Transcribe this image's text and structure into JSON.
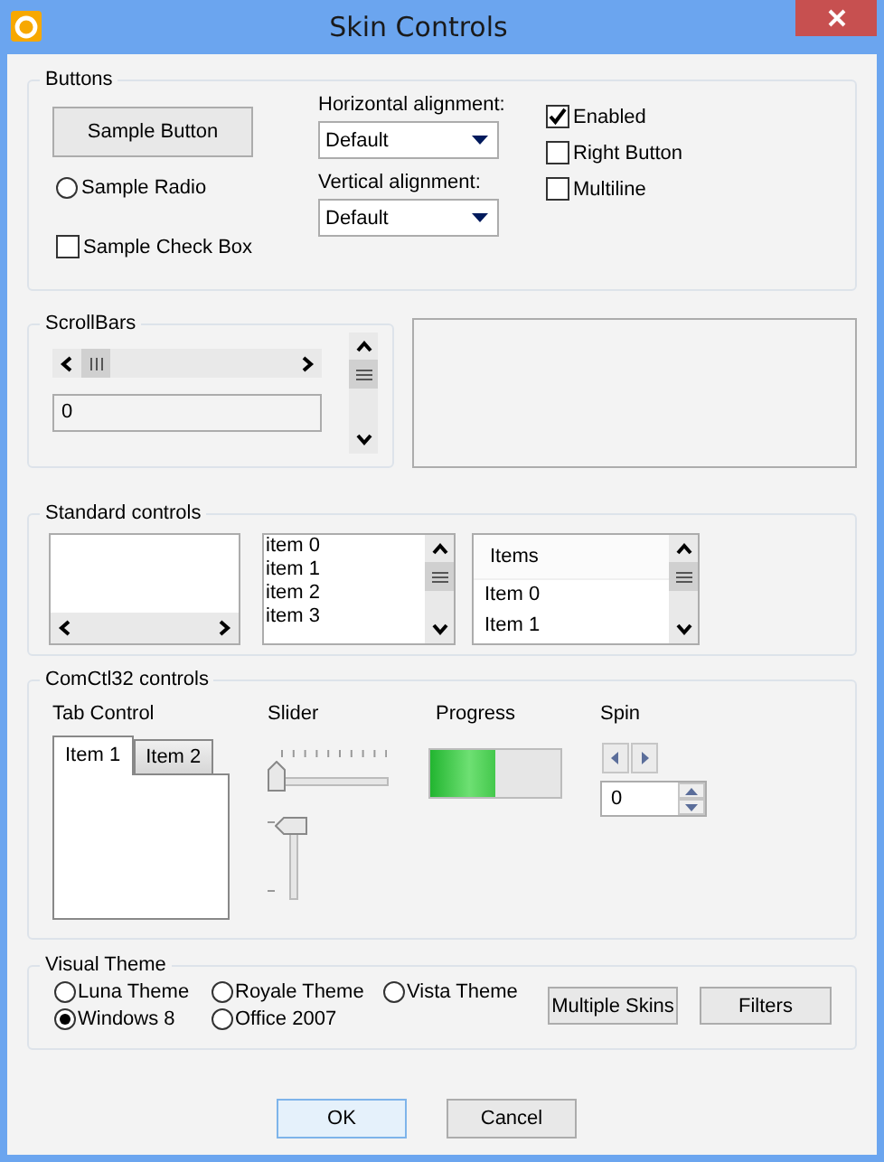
{
  "window": {
    "title": "Skin Controls"
  },
  "buttons_group": {
    "legend": "Buttons",
    "sample_button": "Sample Button",
    "sample_radio": {
      "label": "Sample Radio",
      "selected": false
    },
    "sample_checkbox": {
      "label": "Sample Check Box",
      "checked": false
    },
    "horizontal_alignment": {
      "label": "Horizontal alignment:",
      "value": "Default"
    },
    "vertical_alignment": {
      "label": "Vertical alignment:",
      "value": "Default"
    },
    "options": [
      {
        "label": "Enabled",
        "checked": true
      },
      {
        "label": "Right Button",
        "checked": false
      },
      {
        "label": "Multiline",
        "checked": false
      }
    ]
  },
  "scrollbars_group": {
    "legend": "ScrollBars",
    "edit_value": "0"
  },
  "standard_controls": {
    "legend": "Standard controls",
    "listbox_items": [
      "item 0",
      "item 1",
      "item 2",
      "item 3"
    ],
    "listview": {
      "header": "Items",
      "items": [
        "Item 0",
        "Item 1"
      ]
    }
  },
  "comctl32_controls": {
    "legend": "ComCtl32 controls",
    "tab_control": {
      "label": "Tab Control",
      "tabs": [
        {
          "label": "Item 1",
          "selected": true
        },
        {
          "label": "Item 2",
          "selected": false
        }
      ]
    },
    "slider": {
      "label": "Slider",
      "horizontal": {
        "level": 0
      },
      "vertical": {
        "level": 0
      }
    },
    "progress": {
      "label": "Progress",
      "level": 0.5
    },
    "spin": {
      "label": "Spin",
      "value": "0"
    }
  },
  "visual_theme": {
    "legend": "Visual Theme",
    "themes": [
      {
        "label": "Luna Theme",
        "selected": false
      },
      {
        "label": "Royale Theme",
        "selected": false
      },
      {
        "label": "Vista Theme",
        "selected": false
      },
      {
        "label": "Windows 8",
        "selected": true
      },
      {
        "label": "Office 2007",
        "selected": false
      }
    ],
    "buttons": [
      "Multiple Skins",
      "Filters"
    ]
  },
  "footer_buttons": [
    {
      "label": "OK",
      "default": true
    },
    {
      "label": "Cancel",
      "default": false
    }
  ]
}
